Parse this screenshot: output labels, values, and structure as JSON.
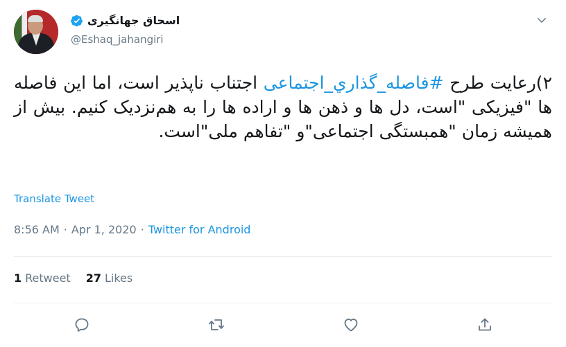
{
  "author": {
    "display_name": "اسحاق جهانگیری",
    "handle": "@Eshaq_jahangiri",
    "verified": true,
    "verified_icon": "verified-badge-icon",
    "avatar": "profile-photo"
  },
  "tweet": {
    "text_prefix": "۲)رعایت طرح ",
    "hashtag": "#فاصله_گذاري_اجتماعی",
    "text_suffix": " اجتناب ناپذیر است، اما این فاصله ها \"فیزیکی \"است، دل ها و ذهن ها و اراده ها را به هم‌نزدیک کنیم. بیش از همیشه زمان \"همبستگی اجتماعی\"و \"تفاهم ملی\"است."
  },
  "translate_label": "Translate Tweet",
  "meta": {
    "time": "8:56 AM",
    "sep1": "·",
    "date": "Apr 1, 2020",
    "sep2": "·",
    "source": "Twitter for Android"
  },
  "stats": {
    "retweets_count": "1",
    "retweets_label": "Retweet",
    "likes_count": "27",
    "likes_label": "Likes"
  },
  "actions": [
    "reply-icon",
    "retweet-icon",
    "like-icon",
    "share-icon"
  ],
  "colors": {
    "accent": "#1b95e0",
    "text": "#14171a",
    "secondary": "#657786",
    "divider": "#e6ecf0"
  }
}
